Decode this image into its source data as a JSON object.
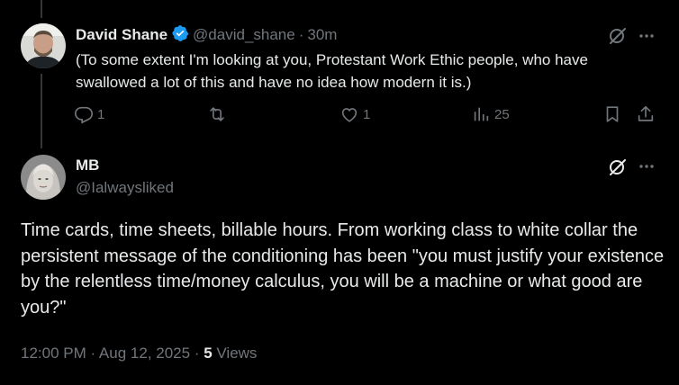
{
  "reply": {
    "author_name": "David Shane",
    "handle": "@david_shane",
    "separator": "·",
    "time": "30m",
    "text": "(To some extent I'm looking at you, Protestant Work Ethic people, who have swallowed a lot of this and have no idea how modern it is.)",
    "verified": true,
    "actions": {
      "replies": "1",
      "reposts": "",
      "likes": "1",
      "views": "25"
    }
  },
  "main_post": {
    "author_name": "MB",
    "handle": "@Ialwaysliked",
    "text": "Time cards, time sheets, billable hours. From working class to white collar the persistent message of the conditioning has been \"you must justify your existence by the relentless time/money calculus, you will be a machine or what good are you?\"",
    "timestamp": "12:00 PM · Aug 12, 2025 · ",
    "views_count": "5",
    "views_label": " Views"
  },
  "colors": {
    "background": "#000000",
    "text": "#e7e9ea",
    "muted": "#71767b",
    "verified_blue": "#1d9bf0",
    "thread_line": "#333639"
  },
  "icons": {
    "reply": "reply-icon",
    "repost": "repost-icon",
    "like": "heart-icon",
    "views": "analytics-icon",
    "bookmark": "bookmark-icon",
    "share": "share-icon",
    "more": "more-icon",
    "grok": "grok-icon",
    "verified": "verified-badge-icon"
  }
}
